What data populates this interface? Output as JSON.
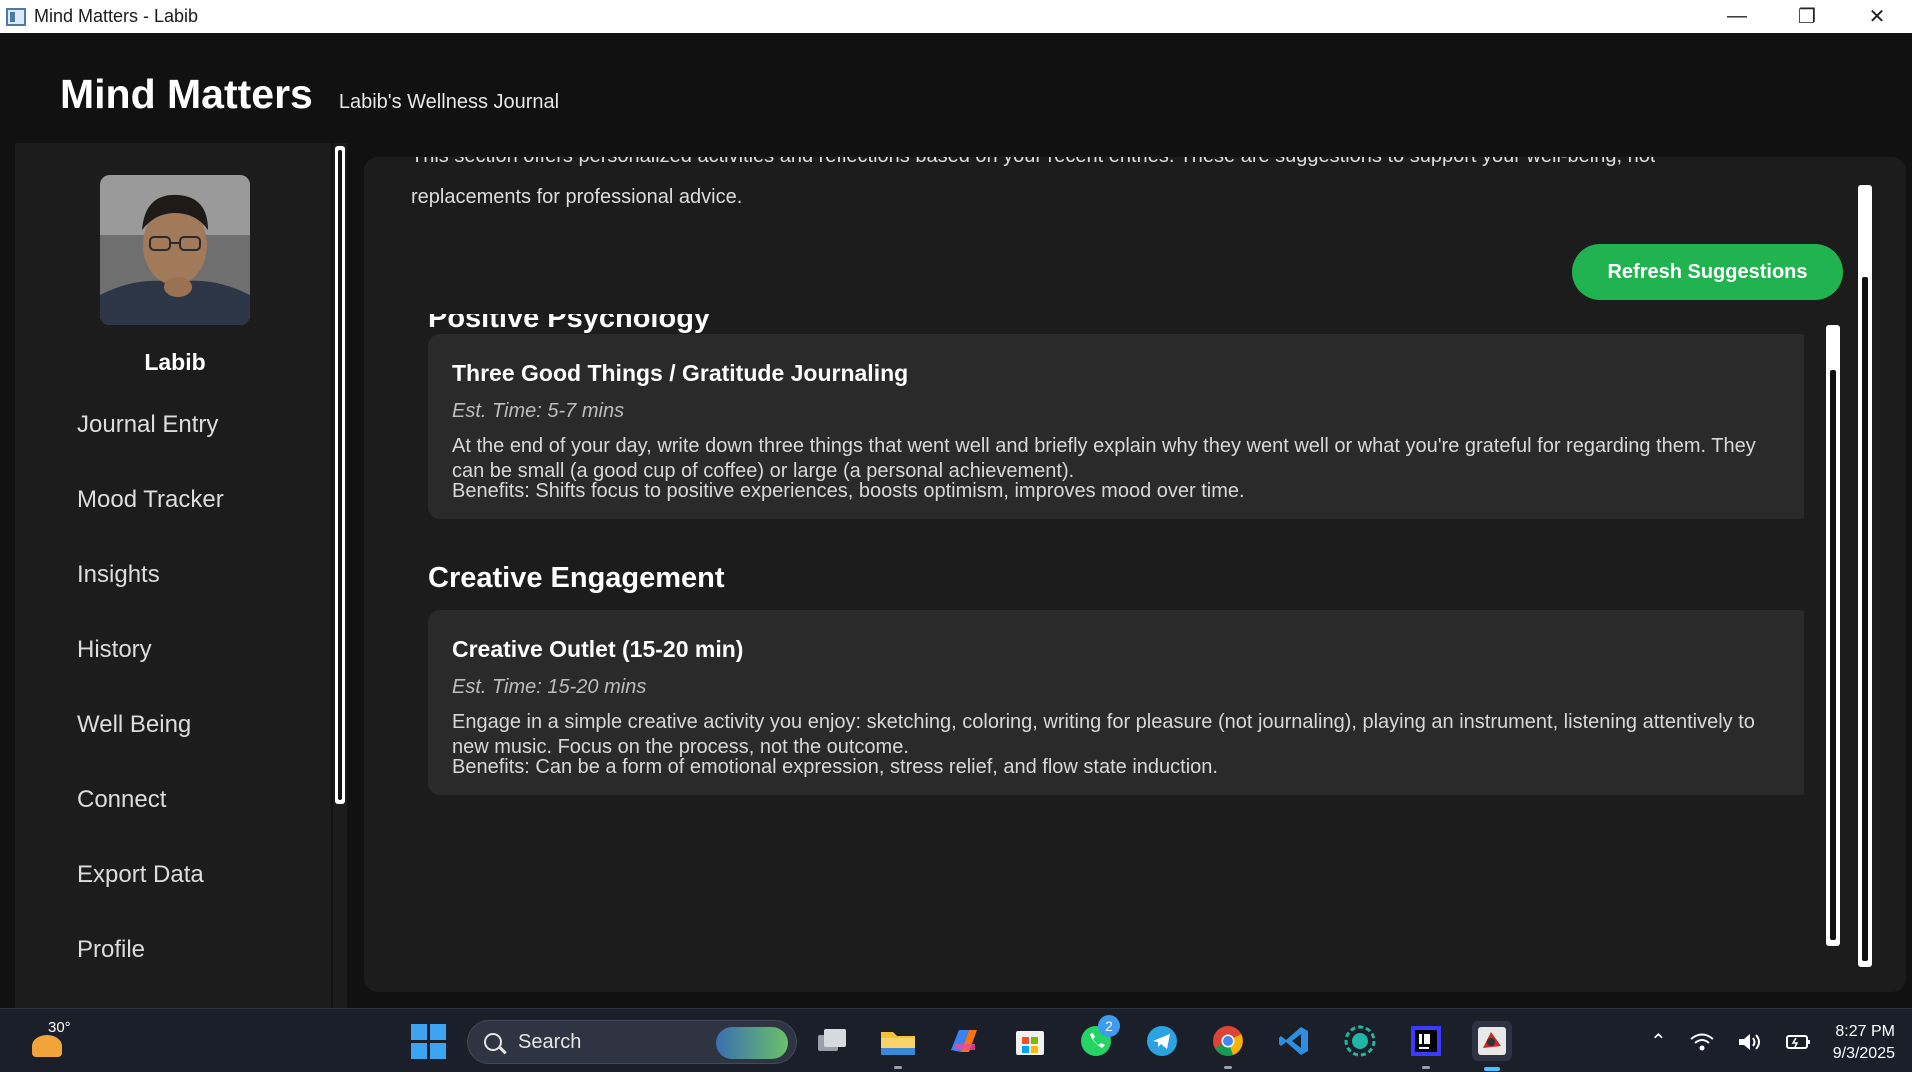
{
  "window": {
    "title": "Mind Matters - Labib",
    "minimize": "—",
    "maximize": "❐",
    "close": "✕"
  },
  "header": {
    "brand": "Mind Matters",
    "subtitle": "Labib's Wellness Journal"
  },
  "sidebar": {
    "username": "Labib",
    "items": [
      {
        "label": "Journal Entry"
      },
      {
        "label": "Mood Tracker"
      },
      {
        "label": "Insights"
      },
      {
        "label": "History"
      },
      {
        "label": "Well Being"
      },
      {
        "label": "Connect"
      },
      {
        "label": "Export Data"
      },
      {
        "label": "Profile"
      }
    ]
  },
  "main": {
    "intro_line1": "This section offers personalized activities and reflections based on your recent entries. These are suggestions to support your well-being, not",
    "intro_line2": "replacements for professional advice.",
    "refresh_label": "Refresh Suggestions",
    "sections": [
      {
        "title": "Positive Psychology",
        "card": {
          "title": "Three Good Things / Gratitude Journaling",
          "time": "Est. Time: 5-7 mins",
          "desc": "At the end of your day, write down three things that went well and briefly explain why they went well or what you're grateful for regarding them. They can be small (a good cup of coffee) or large (a personal achievement).",
          "benefits": "Benefits: Shifts focus to positive experiences, boosts optimism, improves mood over time."
        }
      },
      {
        "title": "Creative Engagement",
        "card": {
          "title": "Creative Outlet (15-20 min)",
          "time": "Est. Time: 15-20 mins",
          "desc": "Engage in a simple creative activity you enjoy: sketching, coloring, writing for pleasure (not journaling), playing an instrument, listening attentively to new music. Focus on the process, not the outcome.",
          "benefits": "Benefits: Can be a form of emotional expression, stress relief, and flow state induction."
        }
      }
    ]
  },
  "taskbar": {
    "weather_temp": "30°",
    "search_label": "Search",
    "whatsapp_badge": "2",
    "time": "8:27 PM",
    "date": "9/3/2025"
  }
}
